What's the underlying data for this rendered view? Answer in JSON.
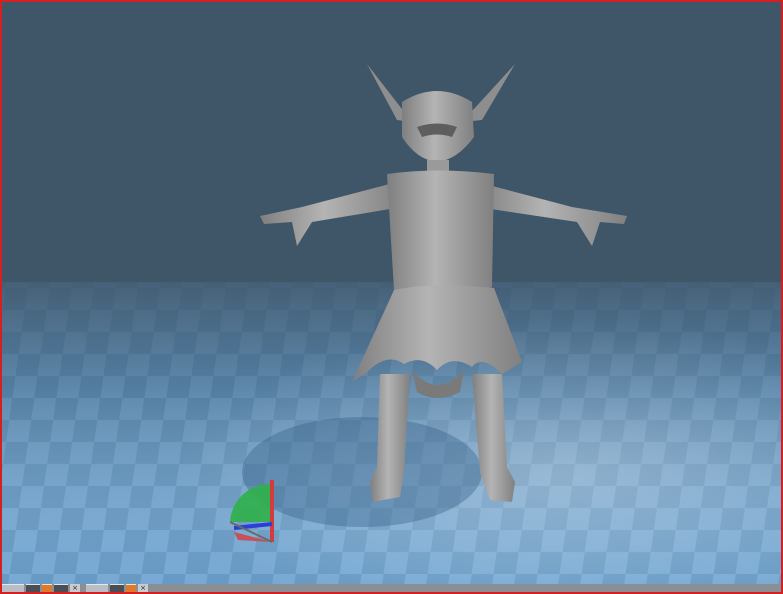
{
  "viewport": {
    "background_color": "#3f5568",
    "floor_colors": [
      "#5d93c0",
      "#6fa4d1"
    ],
    "border_color": "#d42020"
  },
  "model": {
    "name_icon": "goblin-character-mesh",
    "color": "#9c9c9c"
  },
  "gizmo": {
    "icon": "orientation-axes-gizmo",
    "x_color": "#d43c3c",
    "y_color": "#2fb04a",
    "z_color": "#2b3fd6"
  },
  "taskbar": {
    "items": [
      {
        "icon": "window-thumbnail-icon"
      },
      {
        "icon": "folder-icon"
      },
      {
        "icon": "tool-icon"
      },
      {
        "icon": "app-icon"
      },
      {
        "icon": "close-icon",
        "label": "×"
      },
      {
        "icon": "window-thumbnail-icon"
      },
      {
        "icon": "app-icon"
      },
      {
        "icon": "tool-icon"
      },
      {
        "icon": "close-icon",
        "label": "×"
      }
    ]
  }
}
